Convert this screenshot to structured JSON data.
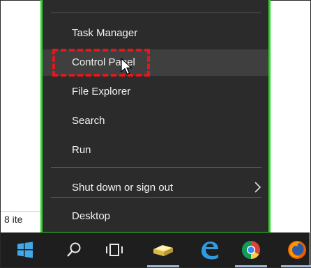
{
  "explorer": {
    "item_count": "8 ite"
  },
  "context_menu": {
    "items": [
      {
        "label": "Task Manager"
      },
      {
        "label": "Control Panel"
      },
      {
        "label": "File Explorer"
      },
      {
        "label": "Search"
      },
      {
        "label": "Run"
      },
      {
        "label": "Shut down or sign out"
      },
      {
        "label": "Desktop"
      }
    ],
    "highlight_color": "#e3171c",
    "frame_color": "#31d62a"
  },
  "taskbar": {
    "icons": [
      "windows-start-icon",
      "search-icon",
      "task-view-icon",
      "file-explorer-icon",
      "edge-icon",
      "chrome-icon",
      "firefox-icon"
    ]
  }
}
